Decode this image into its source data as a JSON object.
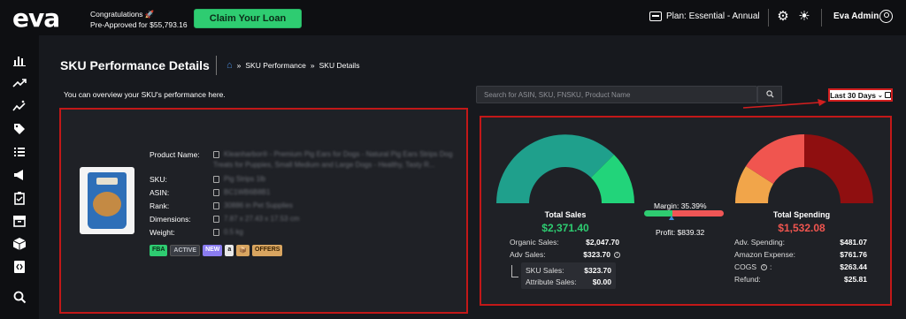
{
  "header": {
    "logo": "eva",
    "congrats_line1": "Congratulations 🚀",
    "congrats_line2": "Pre-Approved for $55,793.16",
    "claim_button": "Claim Your Loan",
    "plan": "Plan: Essential - Annual",
    "user_name": "Eva Admin"
  },
  "sidebar": {
    "icons": [
      "bar-chart-icon",
      "trend-icon",
      "sparkle-chart-icon",
      "tag-icon",
      "list-icon",
      "megaphone-icon",
      "clipboard-icon",
      "archive-icon",
      "box-icon",
      "code-icon",
      "search-icon"
    ]
  },
  "page": {
    "title": "SKU Performance Details",
    "breadcrumb": [
      "SKU Performance",
      "SKU Details"
    ],
    "breadcrumb_sep": "»",
    "overview": "You can overview your SKU's performance here.",
    "search_placeholder": "Search for ASIN, SKU, FNSKU, Product Name",
    "date_range": "Last 30 Days"
  },
  "product": {
    "labels": {
      "name": "Product Name:",
      "sku": "SKU:",
      "asin": "ASIN:",
      "rank": "Rank:",
      "dimensions": "Dimensions:",
      "weight": "Weight:"
    },
    "values": {
      "name_line1": "Kleanharbor® - Premium Pig Ears for Dogs - Natural Pig Ears Strips Dog",
      "name_line2": "Treats for Puppies, Small Medium and Large Dogs - Healthy, Tasty R...",
      "sku": "Pig Strips 1lb",
      "asin": "BC1WB6B8B1",
      "rank": "30886 in Pet Supplies",
      "dimensions": "7.87 x 27.43 x 17.53 cm",
      "weight": "0.5 kg"
    },
    "badges": [
      "FBA",
      "ACTIVE",
      "NEW",
      "a",
      "📦",
      "OFFERS"
    ]
  },
  "sales": {
    "title": "Total Sales",
    "total": "$2,371.40",
    "organic_label": "Organic Sales:",
    "organic_value": "$2,047.70",
    "adv_label": "Adv Sales:",
    "adv_value": "$323.70",
    "sku_sales_label": "SKU Sales:",
    "sku_sales_value": "$323.70",
    "attribute_label": "Attribute Sales:",
    "attribute_value": "$0.00",
    "colors": {
      "organic": "#1fa08c",
      "adv": "#22d47a"
    }
  },
  "margin": {
    "label": "Margin: 35.39%",
    "percent": 35.39,
    "profit": "Profit: $839.32",
    "colors": {
      "positive": "#2ecc71",
      "negative": "#f05656"
    }
  },
  "spending": {
    "title": "Total Spending",
    "total": "$1,532.08",
    "adv_label": "Adv. Spending:",
    "adv_value": "$481.07",
    "amazon_label": "Amazon Expense:",
    "amazon_value": "$761.76",
    "cogs_label": "COGS",
    "cogs_value": "$263.44",
    "refund_label": "Refund:",
    "refund_value": "$25.81",
    "colors": {
      "adv": "#f0554f",
      "amazon": "#8f0f10",
      "cogs": "#f1a54a",
      "total": "#f0554f"
    }
  },
  "accent": {
    "green": "#2ecc71",
    "red_outline": "#c21818",
    "blue": "#4a8ad8"
  }
}
